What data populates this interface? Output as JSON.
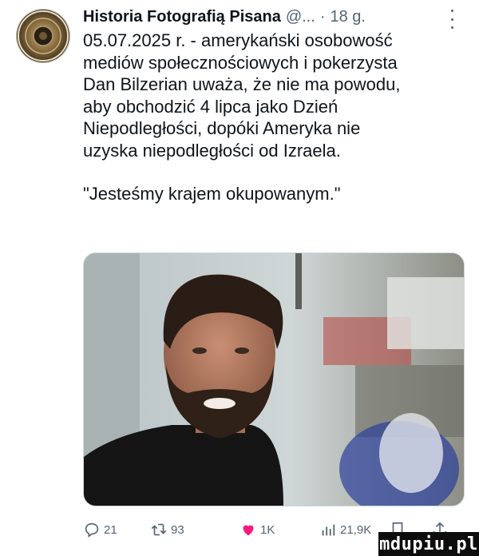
{
  "tweet": {
    "author_name": "Historia Fotografią Pisana",
    "handle": "@...",
    "separator": "·",
    "time": "18 g.",
    "text_lines": [
      "05.07.2025 r. - amerykański osobowość",
      "mediów społecznościowych i pokerzysta",
      "Dan Bilzerian uważa, że nie ma powodu,",
      "aby obchodzić 4 lipca jako Dzień",
      "Niepodległości, dopóki Ameryka nie",
      "uzyska niepodległości od Izraela."
    ],
    "quote": "\"Jesteśmy krajem okupowanym.\""
  },
  "actions": {
    "replies": "21",
    "reposts": "93",
    "likes": "1K",
    "views": "21,9K"
  },
  "watermark": "mdupiu.pl",
  "colors": {
    "text": "#0f1419",
    "muted": "#536471",
    "like": "#f91880",
    "border": "#cfd9de"
  },
  "icons": [
    "reply-icon",
    "repost-icon",
    "heart-icon",
    "views-icon",
    "bookmark-icon",
    "share-icon",
    "more-icon"
  ]
}
